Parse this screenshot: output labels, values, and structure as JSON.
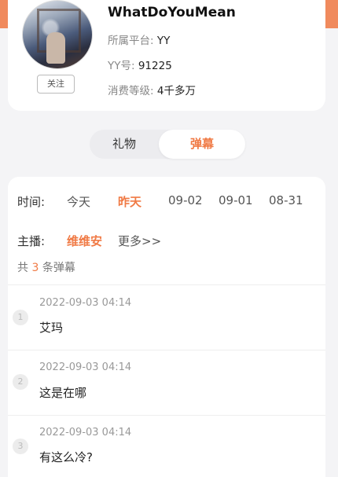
{
  "profile": {
    "username": "WhatDoYouMean",
    "follow_label": "关注",
    "platform_label": "所属平台:",
    "platform_value": "YY",
    "yy_label": "YY号:",
    "yy_value": "91225",
    "level_label": "消费等级:",
    "level_value": "4千多万"
  },
  "tabs": {
    "left": "礼物",
    "right": "弹幕"
  },
  "filters": {
    "time_label": "时间:",
    "time_options": [
      "今天",
      "昨天",
      "09-02",
      "09-01",
      "08-31"
    ],
    "host_label": "主播:",
    "host_selected": "维维安",
    "host_more": "更多>>"
  },
  "summary": {
    "prefix": "共",
    "count": "3",
    "suffix": "条弹幕"
  },
  "messages": [
    {
      "index": "1",
      "time": "2022-09-03 04:14",
      "text": "艾玛"
    },
    {
      "index": "2",
      "time": "2022-09-03 04:14",
      "text": "这是在哪"
    },
    {
      "index": "3",
      "time": "2022-09-03 04:14",
      "text": "有这么冷?"
    }
  ],
  "colors": {
    "accent": "#f07a45",
    "topbar": "#f08a5d",
    "background": "#f4f4f6"
  }
}
